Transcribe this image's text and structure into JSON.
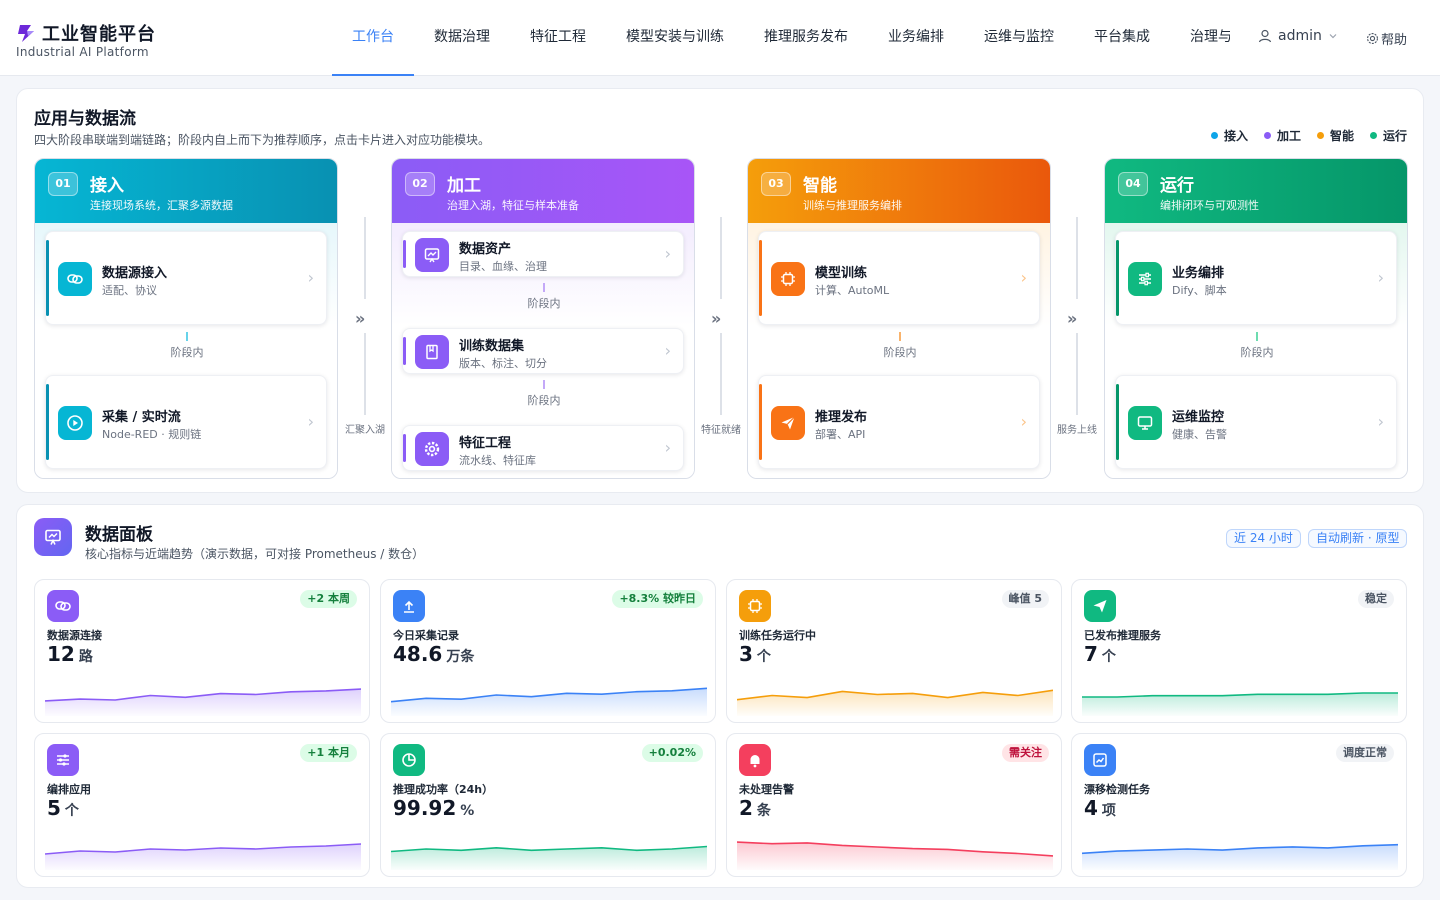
{
  "header": {
    "brand_title": "工业智能平台",
    "brand_subtitle": "Industrial AI Platform",
    "nav": [
      {
        "label": "工作台",
        "active": true
      },
      {
        "label": "数据治理"
      },
      {
        "label": "特征工程"
      },
      {
        "label": "模型安装与训练"
      },
      {
        "label": "推理服务发布"
      },
      {
        "label": "业务编排"
      },
      {
        "label": "运维与监控"
      },
      {
        "label": "平台集成"
      },
      {
        "label": "治理与"
      }
    ],
    "user": "admin",
    "help": "帮助"
  },
  "flow": {
    "title": "应用与数据流",
    "description": "四大阶段串联端到端链路；阶段内自上而下为推荐顺序，点击卡片进入对应功能模块。",
    "legend": [
      {
        "label": "接入",
        "color": "#0ea5e9"
      },
      {
        "label": "加工",
        "color": "#8b5cf6"
      },
      {
        "label": "智能",
        "color": "#f59e0b"
      },
      {
        "label": "运行",
        "color": "#10b981"
      }
    ],
    "stages": [
      {
        "num": "01",
        "name": "接入",
        "desc": "连接现场系统，汇聚多源数据",
        "color": "#0ea5e9",
        "cards": [
          {
            "title": "数据源接入",
            "sub": "适配、协议",
            "icon": "link-icon"
          },
          {
            "title": "采集 / 实时流",
            "sub": "Node-RED · 规则链",
            "icon": "play-icon"
          }
        ],
        "connectors": [
          "阶段内"
        ]
      },
      {
        "num": "02",
        "name": "加工",
        "desc": "治理入湖，特征与样本准备",
        "color": "#8b5cf6",
        "cards": [
          {
            "title": "数据资产",
            "sub": "目录、血缘、治理",
            "icon": "chart-board-icon"
          },
          {
            "title": "训练数据集",
            "sub": "版本、标注、切分",
            "icon": "book-icon"
          },
          {
            "title": "特征工程",
            "sub": "流水线、特征库",
            "icon": "gear-icon"
          }
        ],
        "connectors": [
          "阶段内",
          "阶段内"
        ]
      },
      {
        "num": "03",
        "name": "智能",
        "desc": "训练与推理服务编排",
        "color": "#f97316",
        "cards": [
          {
            "title": "模型训练",
            "sub": "计算、AutoML",
            "icon": "chip-icon"
          },
          {
            "title": "推理发布",
            "sub": "部署、API",
            "icon": "send-icon"
          }
        ],
        "connectors": [
          "阶段内"
        ]
      },
      {
        "num": "04",
        "name": "运行",
        "desc": "编排闭环与可观测性",
        "color": "#10b981",
        "cards": [
          {
            "title": "业务编排",
            "sub": "Dify、脚本",
            "icon": "sliders-icon"
          },
          {
            "title": "运维监控",
            "sub": "健康、告警",
            "icon": "monitor-icon"
          }
        ],
        "connectors": [
          "阶段内"
        ]
      }
    ],
    "transitions": [
      "汇聚入湖",
      "特征就绪",
      "服务上线"
    ]
  },
  "dashboard": {
    "title": "数据面板",
    "description": "核心指标与近端趋势（演示数据，可对接 Prometheus / 数仓）",
    "tags": [
      "近 24 小时",
      "自动刷新 · 原型"
    ],
    "kpis": [
      {
        "label": "数据源连接",
        "value": "12",
        "unit": "路",
        "badge": "+2 本周",
        "badge_tone": "green",
        "icon": "link-icon",
        "color": "#8b5cf6",
        "trend": [
          3,
          3.2,
          3.1,
          3.6,
          3.4,
          3.8,
          3.7,
          4.0,
          4.1,
          4.3
        ]
      },
      {
        "label": "今日采集记录",
        "value": "48.6",
        "unit": "万条",
        "badge": "+8.3% 较昨日",
        "badge_tone": "green",
        "icon": "upload-icon",
        "color": "#3b82f6",
        "trend": [
          3,
          3.4,
          3.3,
          3.8,
          3.6,
          4.0,
          3.9,
          4.2,
          4.3,
          4.6
        ]
      },
      {
        "label": "训练任务运行中",
        "value": "3",
        "unit": "个",
        "badge": "峰值 5",
        "badge_tone": "gray",
        "icon": "chip-icon",
        "color": "#f59e0b",
        "trend": [
          3,
          3.4,
          3.2,
          3.8,
          3.5,
          3.6,
          3.2,
          3.7,
          3.4,
          3.9
        ]
      },
      {
        "label": "已发布推理服务",
        "value": "7",
        "unit": "个",
        "badge": "稳定",
        "badge_tone": "gray",
        "icon": "send-icon",
        "color": "#10b981",
        "trend": [
          4,
          4,
          4.1,
          4.1,
          4.1,
          4.2,
          4.2,
          4.2,
          4.3,
          4.3
        ]
      },
      {
        "label": "编排应用",
        "value": "5",
        "unit": "个",
        "badge": "+1 本月",
        "badge_tone": "green",
        "icon": "sliders-icon",
        "color": "#8b5cf6",
        "trend": [
          3,
          3.3,
          3.2,
          3.5,
          3.4,
          3.6,
          3.5,
          3.7,
          3.8,
          4.0
        ]
      },
      {
        "label": "推理成功率（24h）",
        "value": "99.92",
        "unit": "%",
        "badge": "+0.02%",
        "badge_tone": "green",
        "icon": "pie-icon",
        "color": "#10b981",
        "trend": [
          5,
          5.2,
          5.1,
          5.3,
          5.1,
          5.2,
          5.3,
          5.1,
          5.2,
          5.4
        ]
      },
      {
        "label": "未处理告警",
        "value": "2",
        "unit": "条",
        "badge": "需关注",
        "badge_tone": "red",
        "icon": "bell-icon",
        "color": "#f43f5e",
        "trend": [
          5,
          4.8,
          4.9,
          4.6,
          4.4,
          4.2,
          4.1,
          3.8,
          3.6,
          3.3
        ]
      },
      {
        "label": "漂移检测任务",
        "value": "4",
        "unit": "项",
        "badge": "调度正常",
        "badge_tone": "gray",
        "icon": "trend-icon",
        "color": "#3b82f6",
        "trend": [
          3,
          3.2,
          3.3,
          3.4,
          3.3,
          3.5,
          3.6,
          3.5,
          3.7,
          3.8
        ]
      }
    ]
  }
}
